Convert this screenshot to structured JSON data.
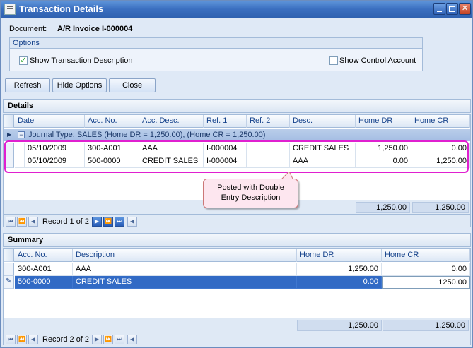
{
  "window": {
    "title": "Transaction Details"
  },
  "document": {
    "label": "Document:",
    "value": "A/R Invoice I-000004"
  },
  "options": {
    "legend": "Options",
    "show_transaction_description": {
      "label": "Show Transaction Description",
      "checked": true
    },
    "show_control_account": {
      "label": "Show Control Account",
      "checked": false
    }
  },
  "toolbar": {
    "refresh": "Refresh",
    "hide_options": "Hide Options",
    "close": "Close"
  },
  "details": {
    "title": "Details",
    "columns": [
      "Date",
      "Acc. No.",
      "Acc. Desc.",
      "Ref. 1",
      "Ref. 2",
      "Desc.",
      "Home DR",
      "Home CR"
    ],
    "group_label": "Journal Type: SALES (Home DR = 1,250.00), (Home CR = 1,250.00)",
    "rows": [
      {
        "date": "05/10/2009",
        "acc_no": "300-A001",
        "acc_desc": "AAA",
        "ref1": "I-000004",
        "ref2": "",
        "desc": "CREDIT SALES",
        "home_dr": "1,250.00",
        "home_cr": "0.00"
      },
      {
        "date": "05/10/2009",
        "acc_no": "500-0000",
        "acc_desc": "CREDIT SALES",
        "ref1": "I-000004",
        "ref2": "",
        "desc": "AAA",
        "home_dr": "0.00",
        "home_cr": "1,250.00"
      }
    ],
    "total_dr": "1,250.00",
    "total_cr": "1,250.00",
    "record_text": "Record 1 of 2"
  },
  "callout": {
    "line1": "Posted with Double",
    "line2": "Entry Description"
  },
  "summary": {
    "title": "Summary",
    "columns": [
      "Acc. No.",
      "Description",
      "Home DR",
      "Home CR"
    ],
    "rows": [
      {
        "acc_no": "300-A001",
        "description": "AAA",
        "home_dr": "1,250.00",
        "home_cr": "0.00"
      },
      {
        "acc_no": "500-0000",
        "description": "CREDIT SALES",
        "home_dr": "0.00",
        "home_cr": "1250.00"
      }
    ],
    "total_dr": "1,250.00",
    "total_cr": "1,250.00",
    "record_text": "Record 2 of 2"
  }
}
